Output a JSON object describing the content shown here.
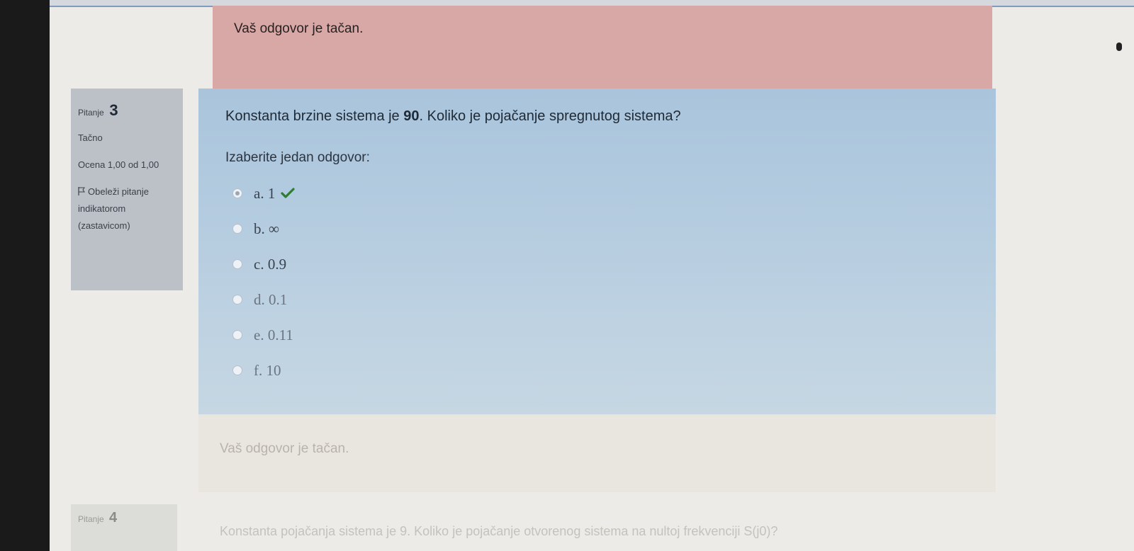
{
  "feedback_top": {
    "text": "Vaš odgovor je tačan."
  },
  "question_info": {
    "label": "Pitanje",
    "number": "3",
    "state": "Tačno",
    "grade": "Ocena 1,00 od 1,00",
    "flag_label": "Obeleži pitanje indikatorom (zastavicom)"
  },
  "question": {
    "text_before": "Konstanta brzine sistema je ",
    "text_value": "90",
    "text_after": ". Koliko je pojačanje spregnutog sistema?",
    "prompt": "Izaberite jedan odgovor:",
    "answers": [
      {
        "label": "a. 1",
        "selected": true,
        "correct_icon": "check-icon"
      },
      {
        "label": "b. ∞",
        "selected": false
      },
      {
        "label": "c. 0.9",
        "selected": false
      },
      {
        "label": "d. 0.1",
        "selected": false
      },
      {
        "label": "e. 0.11",
        "selected": false
      },
      {
        "label": "f. 10",
        "selected": false
      }
    ]
  },
  "feedback_bottom": {
    "text": "Vaš odgovor je tačan."
  },
  "next_question": {
    "label": "Pitanje",
    "number": "4",
    "text": "Konstanta pojačanja sistema je 9. Koliko je pojačanje otvorenog sistema na nultoj frekvenciji S(j0)?"
  },
  "colors": {
    "correct_check": "#2e7d32",
    "feedback_bg": "#d7a8a6",
    "question_bg": "#b6cde0"
  }
}
